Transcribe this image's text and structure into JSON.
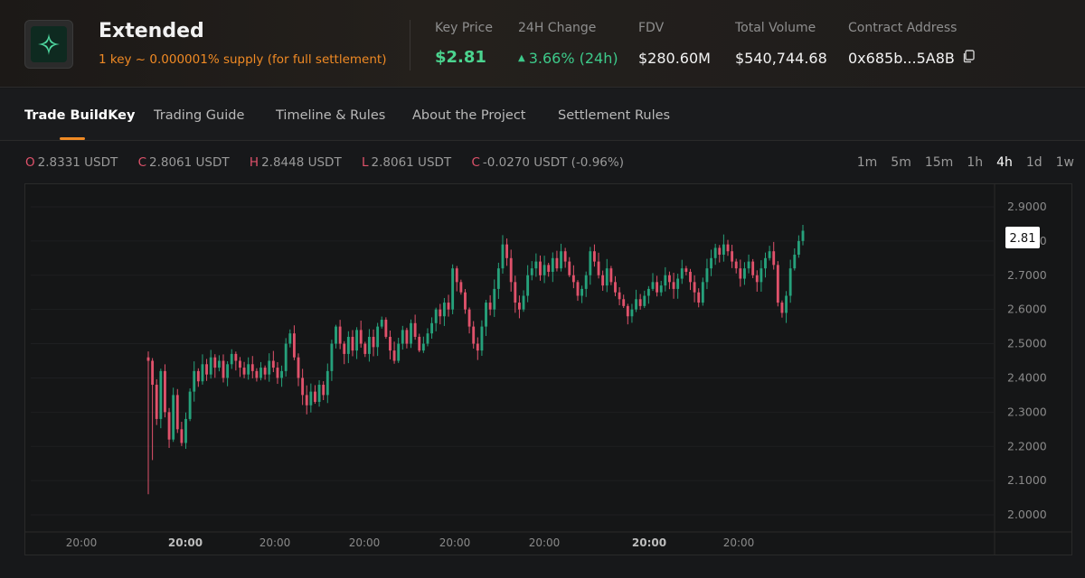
{
  "project": {
    "name": "Extended",
    "subtitle": "1 key ~ 0.000001% supply (for full settlement)",
    "logo_icon": "star-logo-icon"
  },
  "stats": {
    "key_price": {
      "label": "Key Price",
      "value": "$2.81"
    },
    "change_24h": {
      "label": "24H Change",
      "value": "3.66% (24h)",
      "arrow": "up-arrow-icon"
    },
    "fdv": {
      "label": "FDV",
      "value": "$280.60M"
    },
    "total_volume": {
      "label": "Total Volume",
      "value": "$540,744.68"
    },
    "contract_address": {
      "label": "Contract Address",
      "value": "0x685b...5A8B",
      "icon": "copy-icon"
    }
  },
  "tabs": [
    {
      "label": "Trade BuildKey",
      "active": true
    },
    {
      "label": "Trading Guide",
      "active": false
    },
    {
      "label": "Timeline & Rules",
      "active": false
    },
    {
      "label": "About the Project",
      "active": false
    },
    {
      "label": "Settlement Rules",
      "active": false
    }
  ],
  "ohlc": {
    "open": {
      "key": "O",
      "value": "2.8331 USDT"
    },
    "close": {
      "key": "C",
      "value": "2.8061 USDT"
    },
    "high": {
      "key": "H",
      "value": "2.8448 USDT"
    },
    "low": {
      "key": "L",
      "value": "2.8061 USDT"
    },
    "change": {
      "key": "C",
      "value": "-0.0270 USDT (-0.96%)"
    }
  },
  "intervals": [
    "1m",
    "5m",
    "15m",
    "1h",
    "4h",
    "1d",
    "1w"
  ],
  "active_interval": "4h",
  "colors": {
    "up": "#26a17b",
    "down": "#e0526b",
    "accent": "#f08a24",
    "green_text": "#3dc98a"
  },
  "chart_data": {
    "type": "candlestick",
    "y_ticks": [
      "2.9000",
      "2.8000",
      "2.7000",
      "2.6000",
      "2.5000",
      "2.4000",
      "2.3000",
      "2.2000",
      "2.1000",
      "2.0000"
    ],
    "x_ticks": [
      "20:00",
      "20:00",
      "20:00",
      "20:00",
      "20:00",
      "20:00",
      "20:00",
      "20:00"
    ],
    "x_ticks_bold": [
      false,
      true,
      false,
      false,
      false,
      false,
      true,
      false
    ],
    "ylim": [
      1.95,
      2.95
    ],
    "last_price_label": "2.81",
    "last_price": 2.81,
    "closes": [
      2.45,
      2.38,
      2.28,
      2.42,
      2.3,
      2.22,
      2.35,
      2.25,
      2.21,
      2.28,
      2.36,
      2.42,
      2.39,
      2.44,
      2.41,
      2.46,
      2.43,
      2.45,
      2.4,
      2.44,
      2.47,
      2.45,
      2.43,
      2.41,
      2.44,
      2.42,
      2.4,
      2.43,
      2.41,
      2.45,
      2.43,
      2.4,
      2.42,
      2.5,
      2.53,
      2.46,
      2.4,
      2.35,
      2.32,
      2.36,
      2.33,
      2.38,
      2.35,
      2.42,
      2.5,
      2.55,
      2.5,
      2.47,
      2.52,
      2.48,
      2.54,
      2.5,
      2.47,
      2.52,
      2.49,
      2.55,
      2.57,
      2.52,
      2.48,
      2.45,
      2.5,
      2.54,
      2.5,
      2.56,
      2.52,
      2.48,
      2.5,
      2.53,
      2.56,
      2.6,
      2.58,
      2.62,
      2.6,
      2.72,
      2.68,
      2.65,
      2.6,
      2.55,
      2.5,
      2.48,
      2.55,
      2.62,
      2.6,
      2.66,
      2.72,
      2.79,
      2.75,
      2.68,
      2.62,
      2.6,
      2.64,
      2.7,
      2.72,
      2.74,
      2.7,
      2.73,
      2.71,
      2.75,
      2.72,
      2.77,
      2.74,
      2.7,
      2.68,
      2.64,
      2.66,
      2.7,
      2.77,
      2.74,
      2.7,
      2.67,
      2.72,
      2.68,
      2.65,
      2.63,
      2.61,
      2.58,
      2.6,
      2.63,
      2.61,
      2.64,
      2.66,
      2.68,
      2.65,
      2.67,
      2.7,
      2.68,
      2.66,
      2.69,
      2.72,
      2.71,
      2.68,
      2.65,
      2.62,
      2.68,
      2.72,
      2.75,
      2.78,
      2.76,
      2.79,
      2.77,
      2.74,
      2.72,
      2.69,
      2.72,
      2.74,
      2.7,
      2.68,
      2.72,
      2.75,
      2.77,
      2.73,
      2.62,
      2.59,
      2.64,
      2.72,
      2.76,
      2.8,
      2.83
    ],
    "first_open": 2.46
  }
}
